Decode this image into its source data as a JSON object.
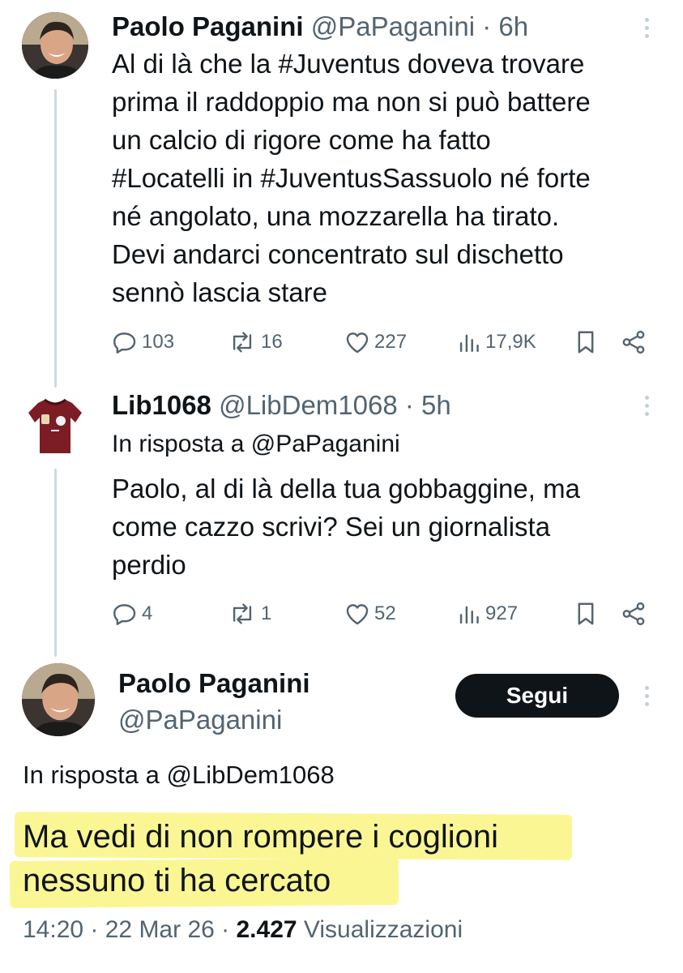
{
  "tweets": [
    {
      "name": "Paolo Paganini",
      "handle": "@PaPaganini",
      "time": "· 6h",
      "text_lines": [
        "Al di là che la #Juventus doveva trovare",
        "prima il raddoppio ma non si può battere",
        "un calcio di rigore come ha fatto",
        "#Locatelli in #JuventusSassuolo né forte",
        "né angolato, una mozzarella ha tirato.",
        "Devi andarci concentrato sul dischetto",
        "sennò lascia stare"
      ],
      "stats": {
        "replies": "103",
        "reposts": "16",
        "likes": "227",
        "views": "17,9K"
      }
    },
    {
      "name": "Lib1068",
      "handle": "@LibDem1068",
      "time": "· 5h",
      "reply_to": "In risposta a @PaPaganini",
      "text_lines": [
        "Paolo, al di là della tua gobbaggine, ma",
        "come cazzo scrivi? Sei un giornalista",
        "perdio"
      ],
      "stats": {
        "replies": "4",
        "reposts": "1",
        "likes": "52",
        "views": "927"
      }
    }
  ],
  "focused_tweet": {
    "name": "Paolo Paganini",
    "handle": "@PaPaganini",
    "follow_label": "Segui",
    "reply_to": "In risposta a @LibDem1068",
    "text_lines": [
      "Ma vedi di non rompere i coglioni",
      "nessuno ti ha cercato"
    ],
    "timestamp": "14:20 · 22 Mar 26 ·",
    "views_count": "2.427",
    "views_label": "Visualizzazioni"
  },
  "colors": {
    "text": "#0f1419",
    "muted": "#536471",
    "thread_line": "#cfd9de",
    "highlight": "#fbf68e",
    "follow_bg": "#0f1419"
  },
  "icons": [
    "reply-icon",
    "repost-icon",
    "like-icon",
    "views-icon",
    "bookmark-icon",
    "share-icon",
    "more-icon",
    "jersey-icon"
  ]
}
